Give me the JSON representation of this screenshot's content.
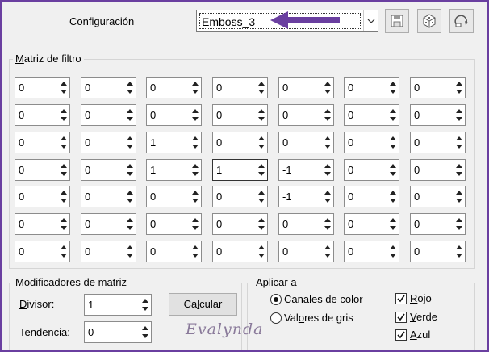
{
  "header": {
    "config_label": "Configuración",
    "preset_value": "Emboss_3",
    "buttons": [
      "save-preset-icon",
      "randomize-dice-icon",
      "reset-icon"
    ]
  },
  "filter_matrix": {
    "title": "Matriz de filtro",
    "rows": [
      [
        "0",
        "0",
        "0",
        "0",
        "0",
        "0",
        "0"
      ],
      [
        "0",
        "0",
        "0",
        "0",
        "0",
        "0",
        "0"
      ],
      [
        "0",
        "0",
        "1",
        "0",
        "0",
        "0",
        "0"
      ],
      [
        "0",
        "0",
        "1",
        "1",
        "-1",
        "0",
        "0"
      ],
      [
        "0",
        "0",
        "0",
        "0",
        "-1",
        "0",
        "0"
      ],
      [
        "0",
        "0",
        "0",
        "0",
        "0",
        "0",
        "0"
      ],
      [
        "0",
        "0",
        "0",
        "0",
        "0",
        "0",
        "0"
      ]
    ]
  },
  "modifiers": {
    "title": "Modificadores de matriz",
    "divisor_label": "Divisor:",
    "divisor_value": "1",
    "bias_label": "Tendencia:",
    "bias_value": "0",
    "calc_label": "Calcular"
  },
  "apply_to": {
    "title": "Aplicar a",
    "radio_color": "Canales de color",
    "radio_gray": "Valores de gris",
    "selected": "color",
    "red": "Rojo",
    "green": "Verde",
    "blue": "Azul",
    "red_checked": true,
    "green_checked": true,
    "blue_checked": true
  },
  "watermark": "Evalynda",
  "colors": {
    "frame": "#6a3fa0",
    "arrow": "#6a3fa0"
  }
}
